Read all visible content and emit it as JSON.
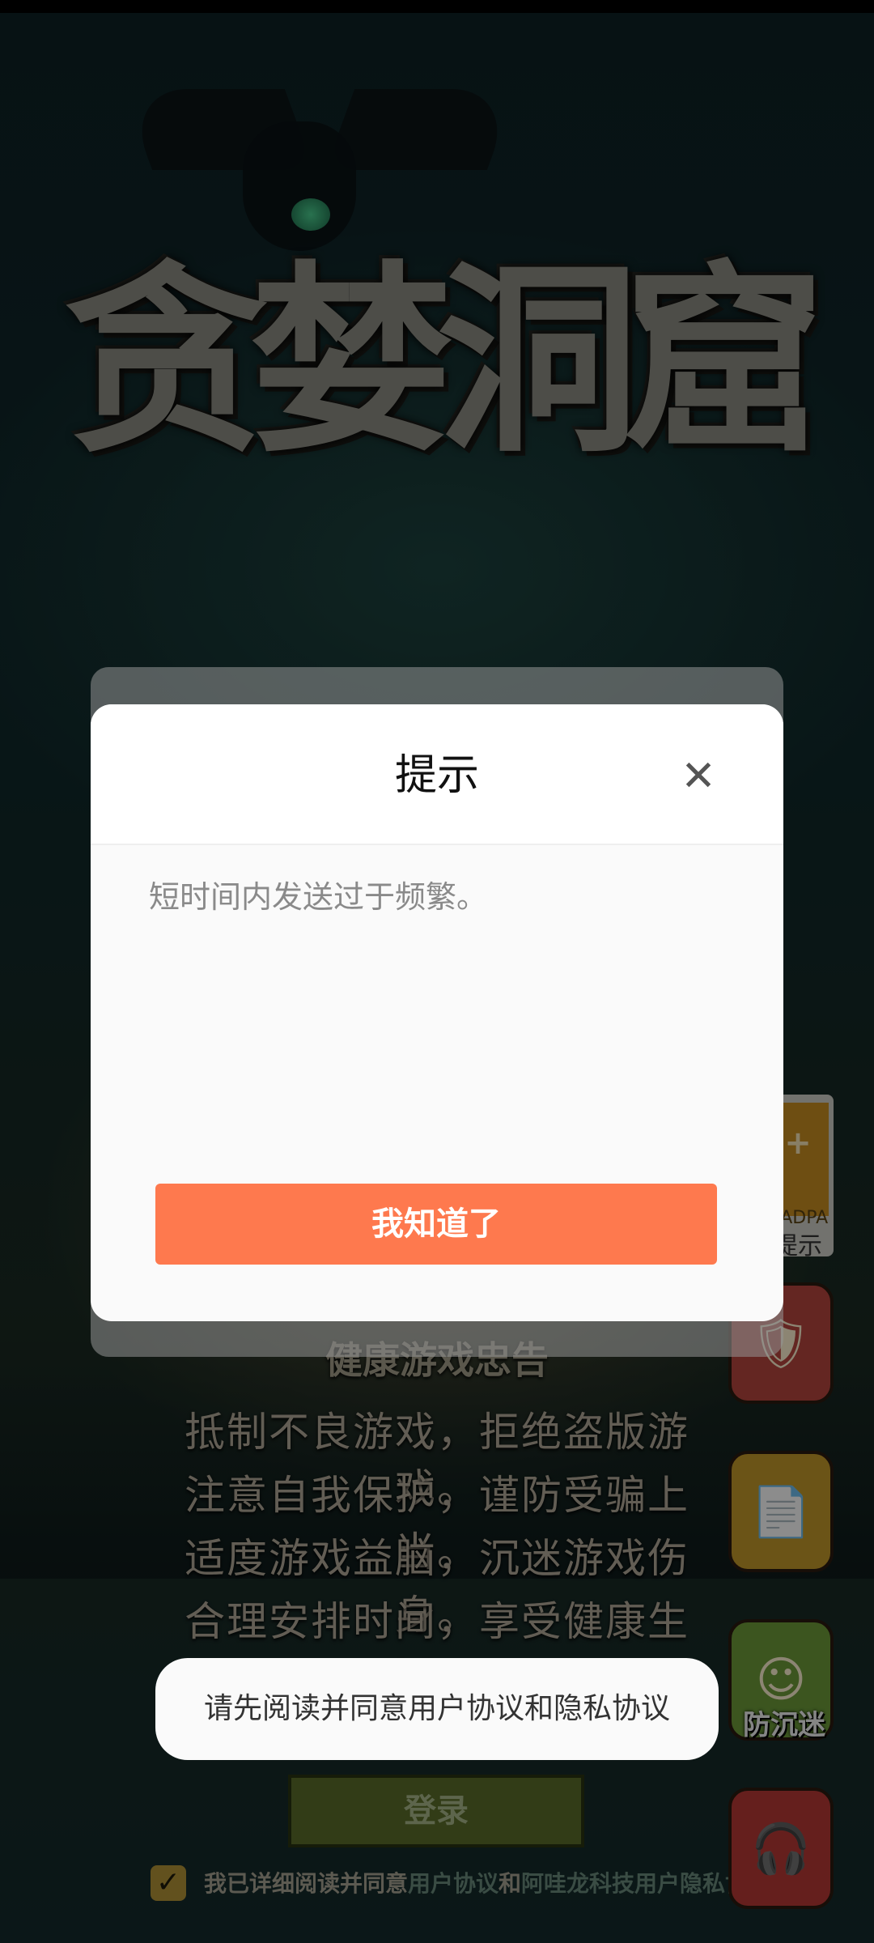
{
  "background": {
    "game_title": "贪婪洞窟",
    "health_notice": {
      "heading": "健康游戏忠告",
      "lines": [
        "抵制不良游戏，拒绝盗版游戏。",
        "注意自我保护，谨防受骗上当。",
        "适度游戏益脑，沉迷游戏伤身。",
        "合理安排时间，享受健康生活。"
      ]
    },
    "login_button": "登录",
    "agreement": {
      "prefix": "我已详细阅读并同意",
      "user_agreement": "用户协议",
      "and": "和",
      "privacy": "阿哇龙科技用户隐私协议"
    },
    "side_buttons": {
      "age_rating_top": "+",
      "age_rating_sub": "CADPA",
      "age_rating_label": "提示",
      "anti_addiction_label": "防沉迷"
    }
  },
  "dialog": {
    "title": "提示",
    "close_glyph": "✕",
    "message": "短时间内发送过于频繁。",
    "confirm_label": "我知道了"
  },
  "toast": {
    "text": "请先阅读并同意用户协议和隐私协议"
  },
  "colors": {
    "confirm_button": "#fe794e",
    "dialog_bg": "#fafafa"
  }
}
